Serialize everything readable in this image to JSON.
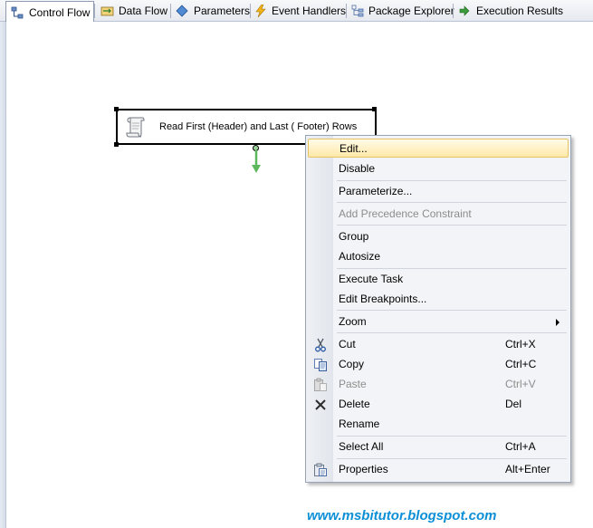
{
  "tabs": [
    {
      "label": "Control Flow",
      "icon": "control-flow-icon",
      "active": true
    },
    {
      "label": "Data Flow",
      "icon": "data-flow-icon",
      "active": false
    },
    {
      "label": "Parameters",
      "icon": "parameters-icon",
      "active": false
    },
    {
      "label": "Event Handlers",
      "icon": "lightning-icon",
      "active": false
    },
    {
      "label": "Package Explorer",
      "icon": "package-explorer-icon",
      "active": false
    },
    {
      "label": "Execution Results",
      "icon": "play-arrow-icon",
      "active": false
    }
  ],
  "task": {
    "label": "Read First (Header) and Last ( Footer) Rows",
    "icon": "script-task-icon"
  },
  "context_menu": {
    "items": [
      {
        "label": "Edit...",
        "highlighted": true
      },
      {
        "label": "Disable"
      },
      {
        "label": "Parameterize..."
      },
      {
        "label": "Add Precedence Constraint",
        "disabled": true
      },
      {
        "label": "Group"
      },
      {
        "label": "Autosize"
      },
      {
        "label": "Execute Task"
      },
      {
        "label": "Edit Breakpoints..."
      },
      {
        "label": "Zoom",
        "submenu": true
      },
      {
        "label": "Cut",
        "shortcut": "Ctrl+X",
        "icon": "scissors-icon"
      },
      {
        "label": "Copy",
        "shortcut": "Ctrl+C",
        "icon": "copy-icon"
      },
      {
        "label": "Paste",
        "shortcut": "Ctrl+V",
        "icon": "paste-icon",
        "disabled": true
      },
      {
        "label": "Delete",
        "shortcut": "Del",
        "icon": "delete-x-icon"
      },
      {
        "label": "Rename"
      },
      {
        "label": "Select All",
        "shortcut": "Ctrl+A"
      },
      {
        "label": "Properties",
        "shortcut": "Alt+Enter",
        "icon": "properties-icon"
      }
    ]
  },
  "watermark": "www.msbitutor.blogspot.com",
  "colors": {
    "highlight": "#ffe9a8",
    "arrow_green": "#5cb85c",
    "watermark": "#0c8fd6"
  }
}
